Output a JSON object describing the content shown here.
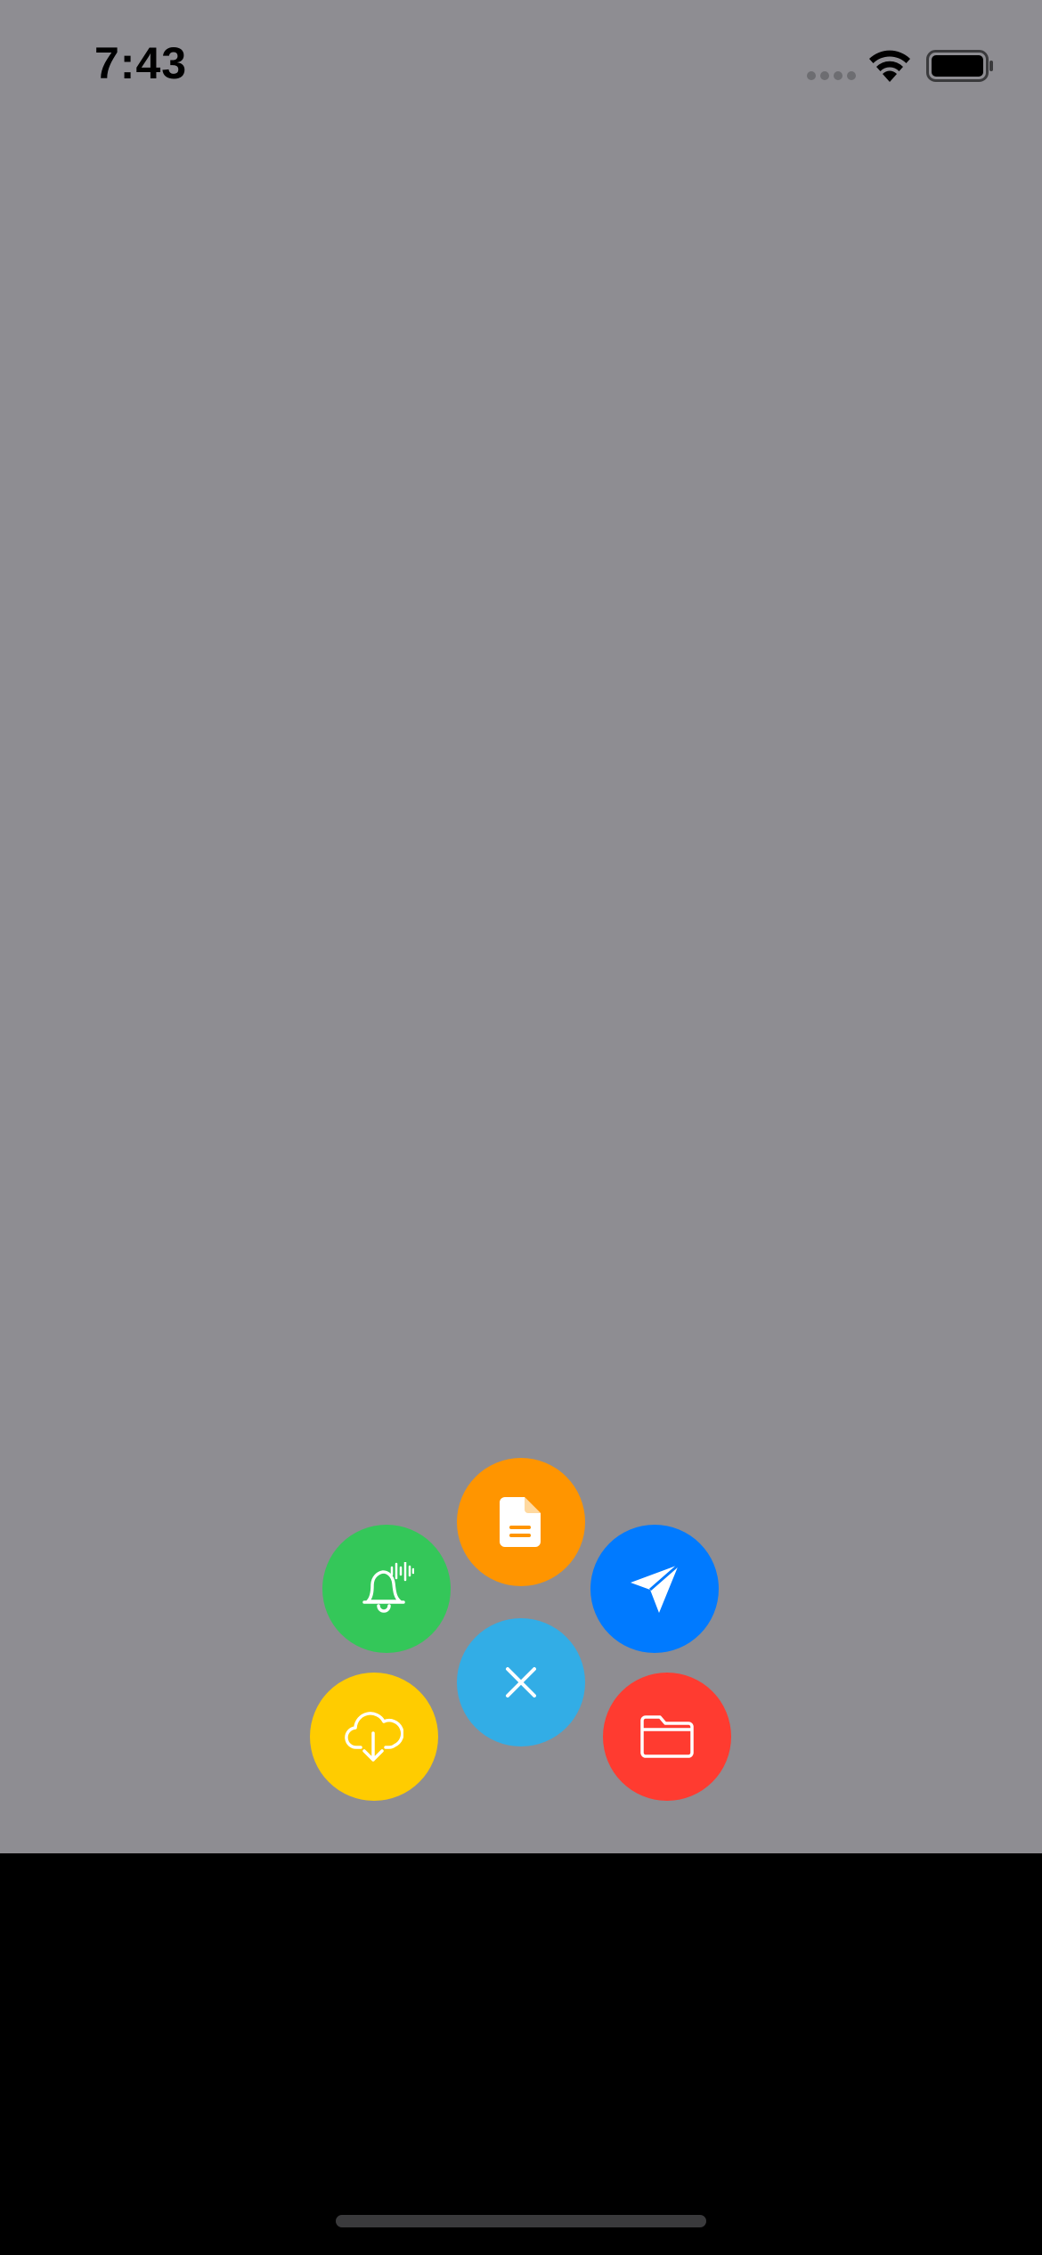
{
  "status_bar": {
    "time": "7:43",
    "icons": [
      "cellular-dots-icon",
      "wifi-icon",
      "battery-icon"
    ]
  },
  "colors": {
    "overlay": "#8e8d92",
    "bottom": "#000000",
    "document": "#ff9500",
    "send": "#007aff",
    "close": "#32ade6",
    "notification": "#34c759",
    "download": "#ffcc00",
    "folder": "#ff3b30"
  },
  "fab_menu": {
    "items": [
      {
        "id": "document",
        "icon": "document-icon"
      },
      {
        "id": "send",
        "icon": "paper-plane-icon"
      },
      {
        "id": "notification",
        "icon": "bell-waveform-icon"
      },
      {
        "id": "download",
        "icon": "cloud-download-icon"
      },
      {
        "id": "folder",
        "icon": "folder-icon"
      }
    ],
    "close": {
      "icon": "close-icon"
    }
  }
}
